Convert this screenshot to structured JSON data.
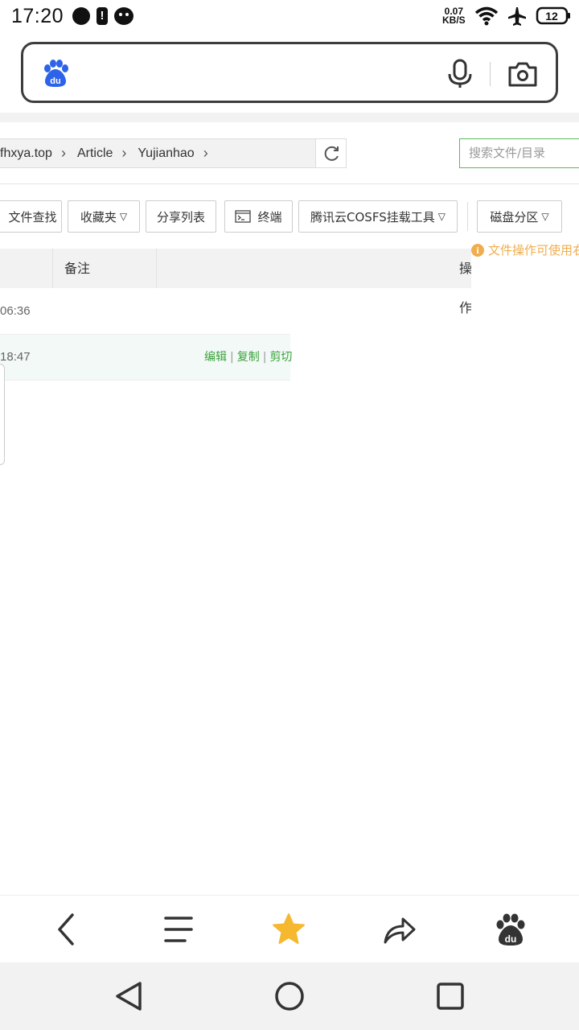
{
  "status_bar": {
    "time": "17:20",
    "net_speed_value": "0.07",
    "net_speed_unit": "KB/S",
    "battery": "12",
    "icons": [
      "notification-dot-icon",
      "alert-icon",
      "chat-icon",
      "wifi-icon",
      "airplane-icon",
      "battery-icon"
    ]
  },
  "search_bar": {
    "placeholder": "",
    "icons": [
      "baidu-logo-icon",
      "microphone-icon",
      "camera-icon"
    ]
  },
  "file_manager": {
    "path": [
      "yfhxya.top",
      "Article",
      "Yujianhao"
    ],
    "search_placeholder": "搜索文件/目录",
    "toolbar": [
      {
        "label": "文件查找",
        "dropdown": false
      },
      {
        "label": "收藏夹",
        "dropdown": true
      },
      {
        "label": "分享列表",
        "dropdown": false
      },
      {
        "label": "终端",
        "dropdown": false
      },
      {
        "label": "腾讯云COSFS挂载工具",
        "dropdown": true
      },
      {
        "label": "磁盘分区",
        "dropdown": true
      }
    ],
    "notice": "文件操作可使用右",
    "table": {
      "headers": {
        "note": "备注",
        "operation": "操作"
      },
      "rows": [
        {
          "time": "06:36",
          "ops": []
        },
        {
          "time": "18:47",
          "ops": [
            "编辑",
            "复制",
            "剪切"
          ]
        }
      ]
    }
  },
  "bottom_nav": {
    "items": [
      "back-icon",
      "menu-icon",
      "favorite-star-icon",
      "share-icon",
      "baidu-home-icon"
    ],
    "accent": "#f5b82e"
  },
  "system_nav": {
    "items": [
      "system-back-icon",
      "system-home-icon",
      "system-recents-icon"
    ]
  }
}
